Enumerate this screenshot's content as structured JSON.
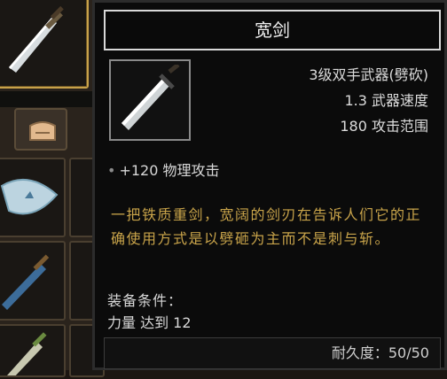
{
  "tooltip": {
    "title": "宽剑",
    "stats": [
      "3级双手武器(劈砍)",
      "1.3 武器速度",
      "180 攻击范围"
    ],
    "bonus_bullet": "•",
    "bonus": "+120 物理攻击",
    "description": "一把铁质重剑，宽阔的剑刃在告诉人们它的正确使用方式是以劈砸为主而不是刺与斩。",
    "requirements_label": "装备条件：",
    "requirements_value": "力量 达到 12",
    "durability": "耐久度：50/50"
  },
  "inventory": {
    "icons": [
      "sword-icon",
      "bag-icon",
      "scroll-icon",
      "sword-icon",
      "sword-icon"
    ]
  },
  "colors": {
    "description": "#c9a44a",
    "panel_bg": "#0b0b0b",
    "selected_border": "#c8a24a"
  }
}
